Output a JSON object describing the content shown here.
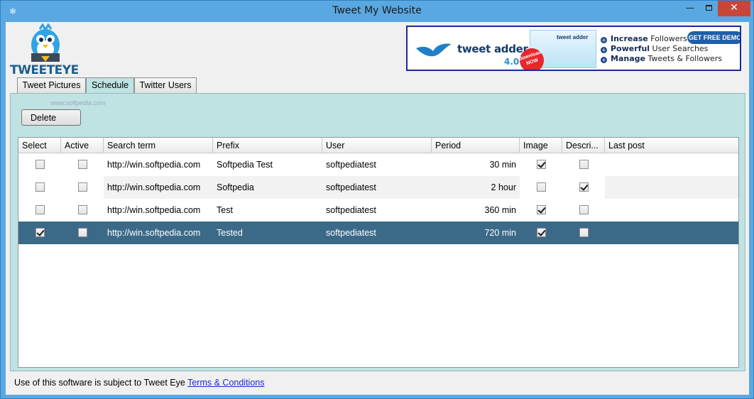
{
  "window": {
    "title": "Tweet My Website",
    "icon": "snowflake-icon"
  },
  "logo": {
    "text_tweet": "TWEET",
    "text_eye": "EYE"
  },
  "banner": {
    "brand": "tweet adder",
    "version": "4.0",
    "box_label": "tweet adder",
    "badge": "download NOW",
    "demo_button": "GET FREE DEMO",
    "features": [
      {
        "bold": "Increase",
        "rest": " Followers"
      },
      {
        "bold": "Powerful",
        "rest": " User Searches"
      },
      {
        "bold": "Manage",
        "rest": " Tweets & Followers"
      }
    ]
  },
  "tabs": [
    {
      "label": "Tweet Pictures",
      "active": false
    },
    {
      "label": "Schedule",
      "active": true
    },
    {
      "label": "Twitter Users",
      "active": false
    }
  ],
  "watermark": "www.softpedia.com",
  "toolbar": {
    "delete_label": "Delete"
  },
  "table": {
    "columns": [
      "Select",
      "Active",
      "Search term",
      "Prefix",
      "User",
      "Period",
      "Image",
      "Descri...",
      "Last post"
    ],
    "rows": [
      {
        "select": false,
        "active": false,
        "search_term": "http://win.softpedia.com",
        "prefix": "Softpedia Test",
        "user": "softpediatest",
        "period": "30 min",
        "image": true,
        "description": false,
        "last_post": "",
        "selected": false
      },
      {
        "select": false,
        "active": false,
        "search_term": "http://win.softpedia.com",
        "prefix": "Softpedia",
        "user": "softpediatest",
        "period": "2 hour",
        "image": false,
        "description": true,
        "last_post": "",
        "selected": false
      },
      {
        "select": false,
        "active": false,
        "search_term": "http://win.softpedia.com",
        "prefix": "Test",
        "user": "softpediatest",
        "period": "360 min",
        "image": true,
        "description": false,
        "last_post": "",
        "selected": false
      },
      {
        "select": true,
        "active": false,
        "search_term": "http://win.softpedia.com",
        "prefix": "Tested",
        "user": "softpediatest",
        "period": "720 min",
        "image": true,
        "description": false,
        "last_post": "",
        "selected": true
      }
    ]
  },
  "footer": {
    "text": "Use of this software is subject to Tweet Eye ",
    "link": "Terms & Conditions"
  },
  "colors": {
    "titlebar": "#5aa8e2",
    "panel": "#bfe3e3",
    "selected_row": "#3b6a89",
    "close_button": "#c7463a",
    "link": "#1a2ad0"
  }
}
